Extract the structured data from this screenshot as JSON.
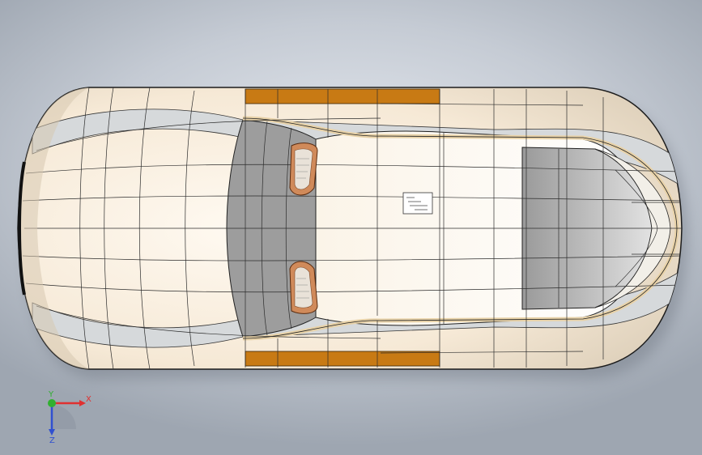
{
  "viewport": {
    "background_top": "#e6eaf0",
    "background_bottom": "#9ea6b1"
  },
  "model": {
    "body_color": "#fff8ec",
    "trim_color": "#c87a14",
    "glass_color": "#9b9b9b",
    "mesh_line_color": "#2b2b2b",
    "headlight_color": "#c46a3c"
  },
  "triad": {
    "x_label": "X",
    "y_label": "Y",
    "z_label": "Z",
    "x_color": "#e03030",
    "y_color": "#30b030",
    "z_color": "#3050d0"
  }
}
